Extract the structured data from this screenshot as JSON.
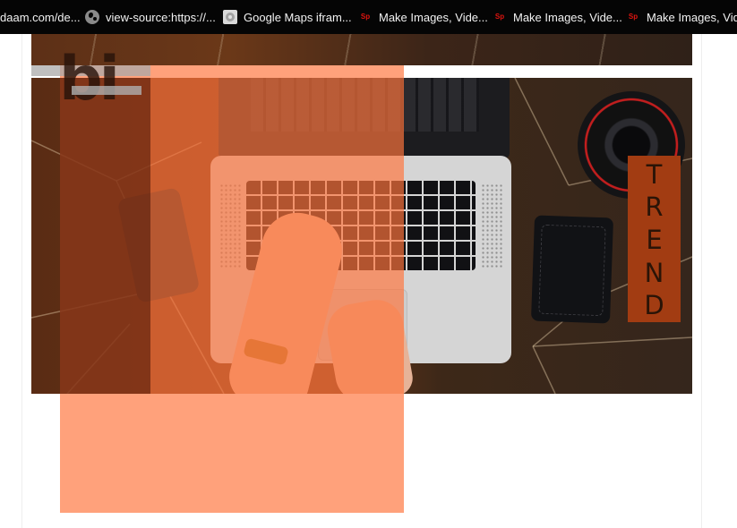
{
  "bookmarks": {
    "items": [
      {
        "label": "daam.com/de...",
        "icon": "none"
      },
      {
        "label": "view-source:https://...",
        "icon": "globe-icon"
      },
      {
        "label": "Google Maps ifram...",
        "icon": "maps-icon"
      },
      {
        "label": "Make Images, Vide...",
        "icon": "sp-icon",
        "icon_text": "Sp"
      },
      {
        "label": "Make Images, Vide...",
        "icon": "sp-icon",
        "icon_text": "Sp"
      },
      {
        "label": "Make Images, Vide",
        "icon": "sp-icon",
        "icon_text": "Sp"
      }
    ]
  },
  "logo": {
    "text": "bi"
  },
  "badge": {
    "letters": [
      "T",
      "R",
      "E",
      "N",
      "D"
    ]
  },
  "colors": {
    "overlay_orange": "#ff743c",
    "badge_bg": "#a23c12",
    "badge_text": "#2a1407",
    "bookmarks_bg": "#050505"
  }
}
